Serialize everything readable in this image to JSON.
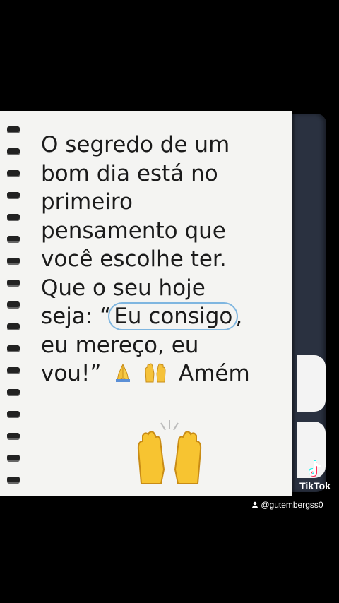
{
  "message": {
    "line1": "O segredo de um",
    "line2": "bom dia está no",
    "line3": "primeiro",
    "line4": "pensamento que",
    "line5": "você escolhe ter.",
    "line6": "Que o seu hoje",
    "line7a": "seja: “",
    "line7b": "Eu consigo",
    "line7c": ",",
    "line8": "eu mereço, eu",
    "line9a": "vou!”",
    "line9b": "Amém"
  },
  "icons": [
    "praying-hands-emoji",
    "raising-hands-emoji",
    "raising-hands-large-emoji",
    "tiktok-logo",
    "user-icon"
  ],
  "watermark": {
    "brand": "TikTok",
    "handle": "@gutembergss0"
  }
}
